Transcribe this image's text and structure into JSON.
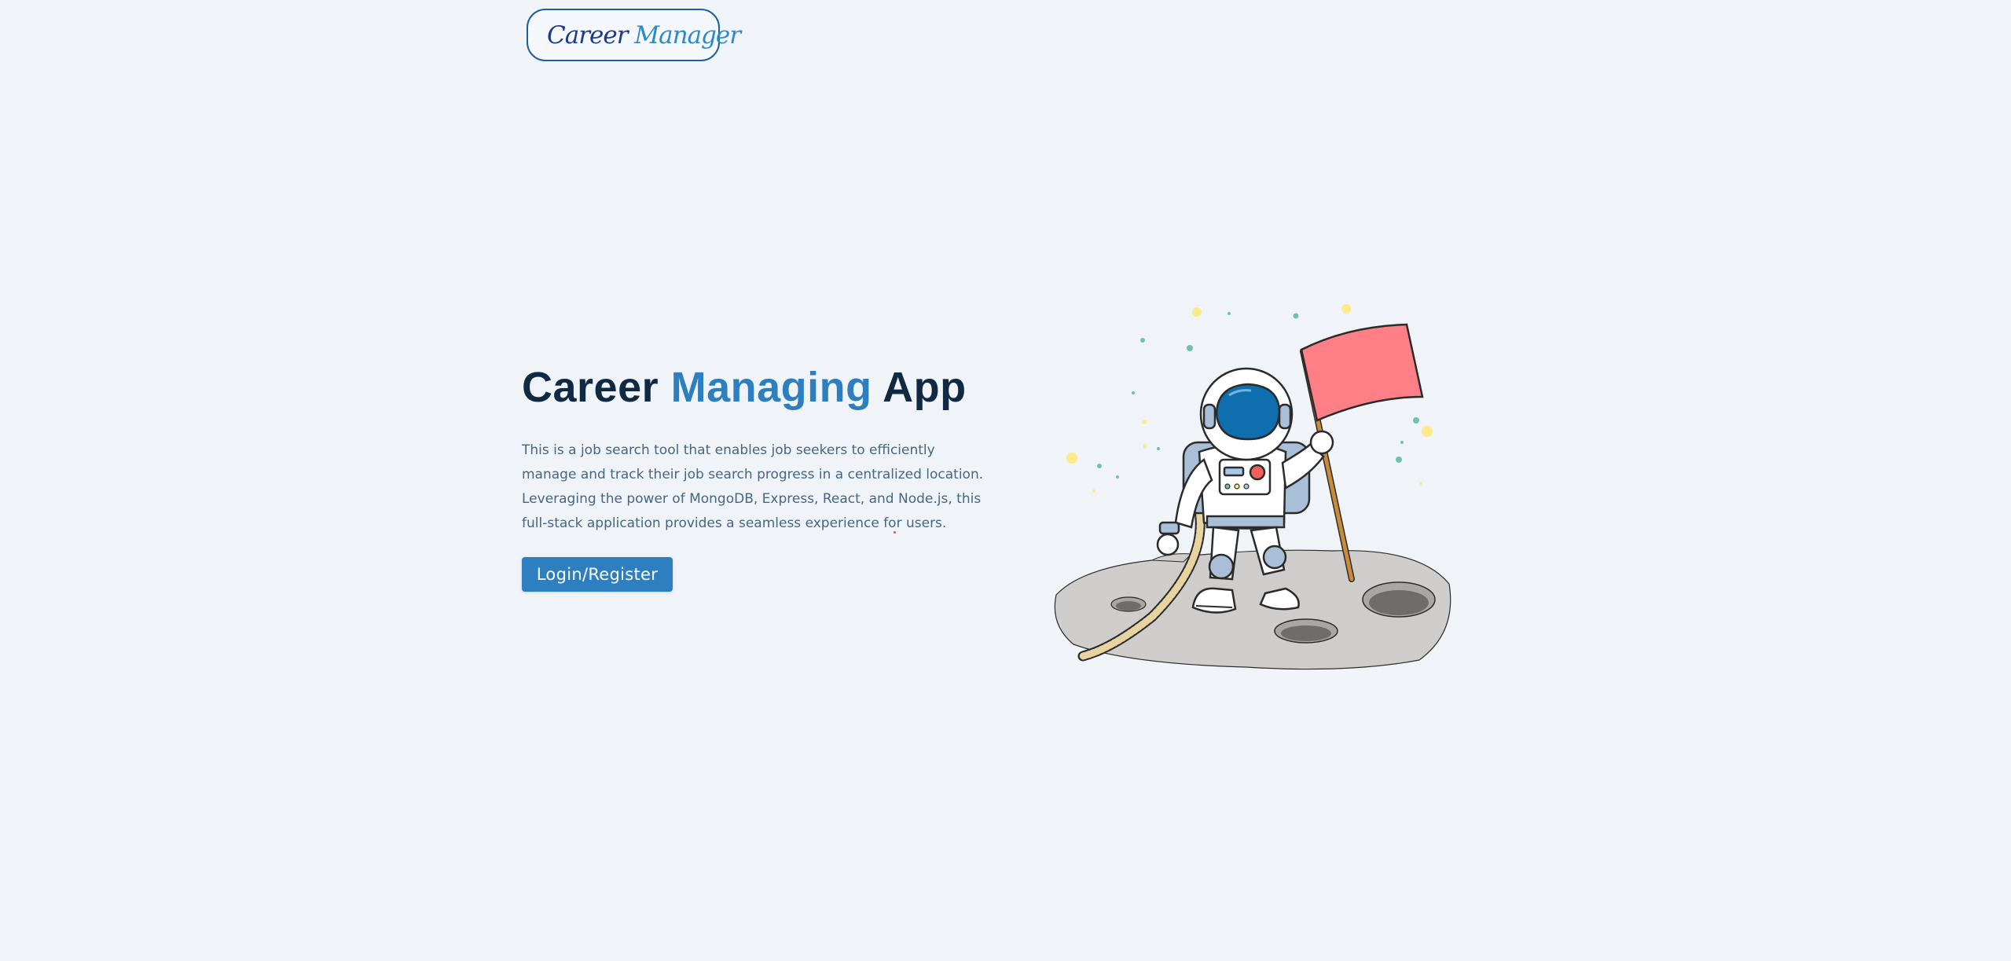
{
  "logo": {
    "text_first": "Career",
    "text_second": "Manager",
    "icon": "running-man-briefcase-icon"
  },
  "hero": {
    "title_before": "Career",
    "title_accent": "Managing",
    "title_after": "App",
    "description": "This is a job search tool that enables job seekers to efficiently manage and track their job search progress in a centralized location. Leveraging the power of MongoDB, Express, React, and Node.js, this full-stack application provides a seamless experience for users.",
    "cta_label": "Login/Register",
    "illustration": "astronaut-flag-moon-illustration"
  },
  "colors": {
    "background": "#f0f4f8",
    "heading": "#102a43",
    "accent": "#2d7fbf",
    "body_text": "#486581",
    "logo_border": "#1e5f9a",
    "flag": "#ff7f86",
    "visor": "#0f6fae",
    "moon": "#cfcccc"
  }
}
